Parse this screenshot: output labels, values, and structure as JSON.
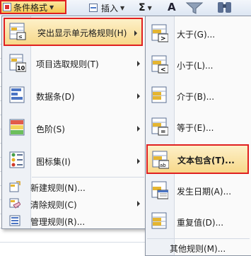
{
  "ribbon": {
    "conditional_format_label": "条件格式",
    "insert_label": "插入",
    "sigma": "Σ",
    "sort_letter": "A"
  },
  "menu": {
    "items": [
      {
        "label": "突出显示单元格规则(H)",
        "icon": "highlight-cells-icon",
        "submenu": true,
        "highlighted": true
      },
      {
        "label": "项目选取规则(T)",
        "icon": "top-10-icon",
        "submenu": true
      },
      {
        "label": "数据条(D)",
        "icon": "data-bars-icon",
        "submenu": true
      },
      {
        "label": "色阶(S)",
        "icon": "color-scales-icon",
        "submenu": true
      },
      {
        "label": "图标集(I)",
        "icon": "icon-sets-icon",
        "submenu": true
      },
      {
        "label": "新建规则(N)...",
        "icon": "new-rule-icon"
      },
      {
        "label": "清除规则(C)",
        "icon": "clear-rules-icon",
        "submenu": true
      },
      {
        "label": "管理规则(R)...",
        "icon": "manage-rules-icon"
      }
    ]
  },
  "submenu": {
    "items": [
      {
        "label": "大于(G)...",
        "icon": "greater-than-icon"
      },
      {
        "label": "小于(L)...",
        "icon": "less-than-icon"
      },
      {
        "label": "介于(B)...",
        "icon": "between-icon"
      },
      {
        "label": "等于(E)...",
        "icon": "equal-to-icon"
      },
      {
        "label": "文本包含(T)...",
        "icon": "text-contains-icon",
        "highlighted": true
      },
      {
        "label": "发生日期(A)...",
        "icon": "date-occurring-icon"
      },
      {
        "label": "重复值(D)...",
        "icon": "duplicate-values-icon"
      }
    ],
    "more_rules": "其他规则(M)..."
  },
  "colors": {
    "highlight_border": "#e02020",
    "highlight_fill": "#f7d88a"
  }
}
